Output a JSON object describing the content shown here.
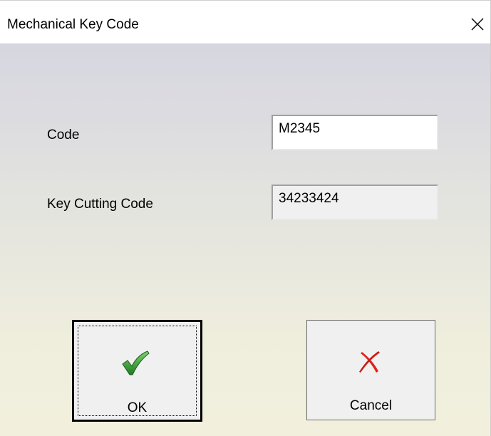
{
  "window": {
    "title": "Mechanical Key Code",
    "close_icon": "close-icon"
  },
  "form": {
    "code": {
      "label": "Code",
      "value": "M2345"
    },
    "key_cutting_code": {
      "label": "Key Cutting Code",
      "value": "34233424"
    }
  },
  "buttons": {
    "ok": {
      "label": "OK",
      "icon": "checkmark-icon",
      "icon_color": "#2e8b2e"
    },
    "cancel": {
      "label": "Cancel",
      "icon": "cross-icon",
      "icon_color": "#cc2020"
    }
  },
  "colors": {
    "gradient_top": "#d6d6e0",
    "gradient_bottom": "#f2f0dd",
    "button_face": "#f0f0f0"
  }
}
